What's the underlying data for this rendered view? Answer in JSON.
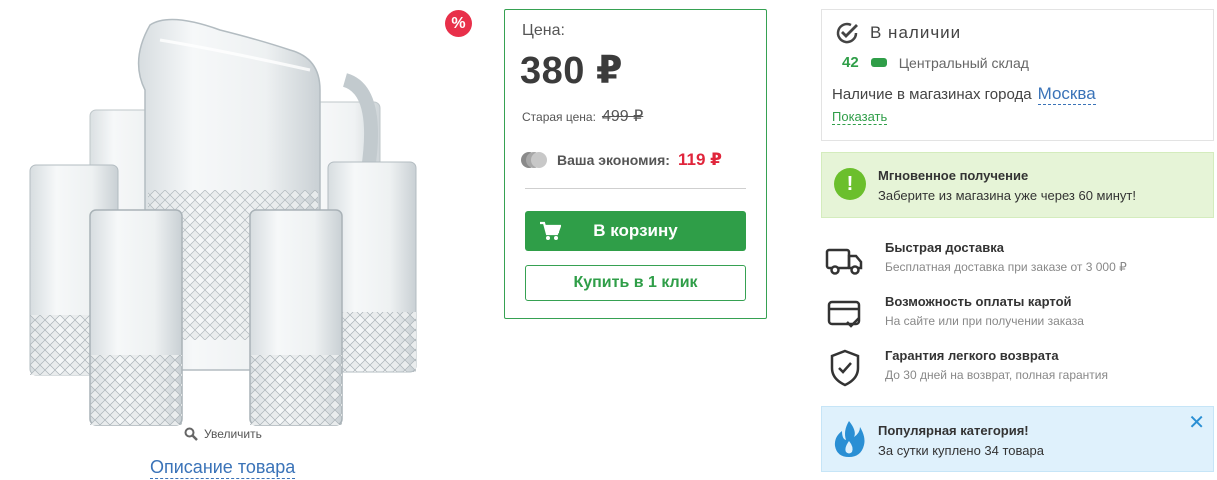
{
  "product": {
    "sale_badge": "%",
    "zoom_label": "Увеличить",
    "description_link": "Описание товара"
  },
  "price": {
    "label": "Цена:",
    "value": "380 ₽",
    "old_label": "Старая цена:",
    "old_value": "499 ₽",
    "economy_label": "Ваша экономия:",
    "economy_value": "119 ₽",
    "cart_button": "В корзину",
    "buy_one_click_button": "Купить в 1 клик"
  },
  "availability": {
    "status": "В наличии",
    "count": "42",
    "warehouse": "Центральный склад",
    "city_text": "Наличие в магазинах города",
    "city": "Москва",
    "show_link": "Показать"
  },
  "instant": {
    "icon": "!",
    "title": "Мгновенное получение",
    "subtitle": "Заберите из магазина уже через 60 минут!"
  },
  "features": [
    {
      "icon": "truck-icon",
      "title": "Быстрая доставка",
      "subtitle": "Бесплатная доставка при заказе от 3 000 ₽"
    },
    {
      "icon": "card-icon",
      "title": "Возможность оплаты картой",
      "subtitle": "На сайте или при получении заказа"
    },
    {
      "icon": "shield-icon",
      "title": "Гарантия легкого возврата",
      "subtitle": "До 30 дней на возврат, полная гарантия"
    }
  ],
  "popular": {
    "title": "Популярная категория!",
    "subtitle": "За сутки куплено 34 товара",
    "close": "✕"
  },
  "colors": {
    "accent_green": "#2f9e48",
    "price_red": "#e0253b",
    "link_blue": "#3a73b8",
    "sale_badge": "#e8304a"
  }
}
